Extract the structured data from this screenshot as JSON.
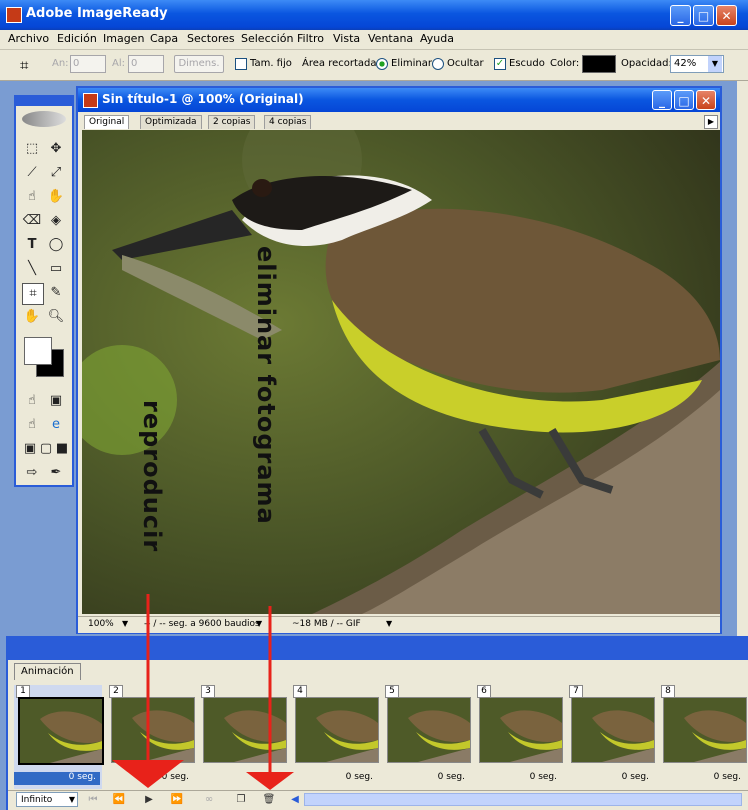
{
  "app": {
    "title": "Adobe ImageReady"
  },
  "window_controls": {
    "minimize": "_",
    "maximize": "□",
    "close": "✕"
  },
  "menu": [
    "Archivo",
    "Edición",
    "Imagen",
    "Capa",
    "Sectores",
    "Selección",
    "Filtro",
    "Vista",
    "Ventana",
    "Ayuda"
  ],
  "options": {
    "an_label": "An:",
    "an_value": "0",
    "al_label": "Al:",
    "al_value": "0",
    "dimens_button": "Dimens.",
    "tam_fijo": "Tam. fijo",
    "area_label": "Área recortada:",
    "eliminar": "Eliminar",
    "ocultar": "Ocultar",
    "escudo": "Escudo",
    "color_label": "Color:",
    "color_value": "#000000",
    "opacidad_label": "Opacidad:",
    "opacidad_value": "42%"
  },
  "document": {
    "title": "Sin título-1 @ 100% (Original)",
    "tabs": [
      "Original",
      "Optimizada",
      "2 copias",
      "4 copias"
    ],
    "status": {
      "zoom": "100%",
      "speed": "-- / -- seg. a 9600 baudios",
      "size": "~18 MB / -- GIF"
    }
  },
  "annotations": {
    "delete": "eliminar fotograma",
    "play": "reproducir"
  },
  "animation": {
    "tab": "Animación",
    "frames": [
      {
        "num": "1",
        "delay": "0 seg."
      },
      {
        "num": "2",
        "delay": "0 seg."
      },
      {
        "num": "3",
        "delay": "0 seg."
      },
      {
        "num": "4",
        "delay": "0 seg."
      },
      {
        "num": "5",
        "delay": "0 seg."
      },
      {
        "num": "6",
        "delay": "0 seg."
      },
      {
        "num": "7",
        "delay": "0 seg."
      },
      {
        "num": "8",
        "delay": "0 seg."
      }
    ],
    "loop": "Infinito"
  },
  "colors": {
    "accent": "#2a5cd8",
    "arrow": "#e8221a"
  }
}
